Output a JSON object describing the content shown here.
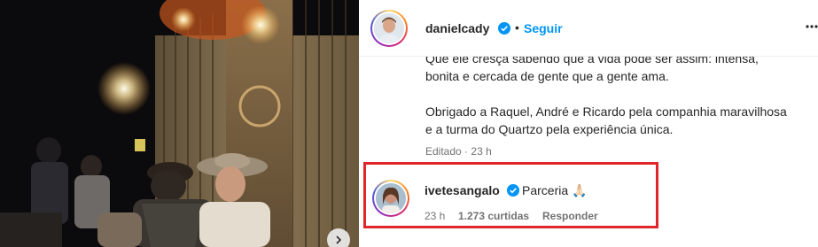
{
  "post": {
    "username": "danielcady",
    "separator": "•",
    "follow_label": "Seguir",
    "caption_lines": [
      "Que ele cresça sabendo que a vida pode ser assim: intensa,",
      "bonita e cercada de gente que a gente ama.",
      "Obrigado a Raquel, André e Ricardo pela companhia maravilhosa",
      "e a turma do Quartzo pela experiência única."
    ],
    "edited_label": "Editado",
    "edited_sep": "·",
    "edited_time": "23 h"
  },
  "comment": {
    "username": "ivetesangalo",
    "text": "Parceria",
    "emoji": "🙏🏻",
    "time": "23 h",
    "likes": "1.273 curtidas",
    "reply_label": "Responder"
  },
  "colors": {
    "accent": "#0095f6",
    "highlight": "#e0262b",
    "muted": "#737373"
  },
  "icons": [
    "verified-badge-icon",
    "more-options-icon",
    "carousel-next-icon"
  ]
}
